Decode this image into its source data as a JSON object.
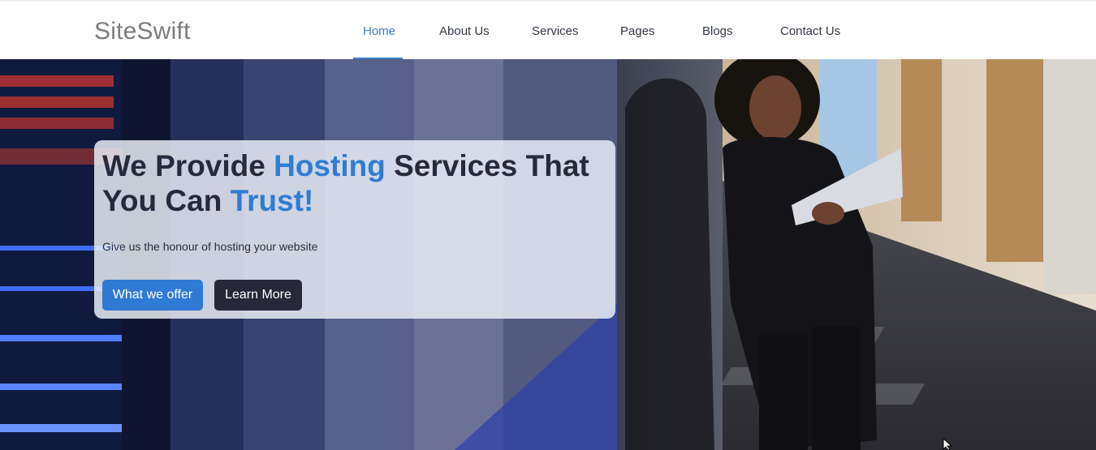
{
  "header": {
    "brand": "SiteSwift",
    "nav": [
      {
        "label": "Home",
        "active": true
      },
      {
        "label": "About Us",
        "active": false
      },
      {
        "label": "Services",
        "active": false
      },
      {
        "label": "Pages",
        "active": false
      },
      {
        "label": "Blogs",
        "active": false
      },
      {
        "label": "Contact Us",
        "active": false
      }
    ],
    "accent_color": "#3e7fc6"
  },
  "hero": {
    "title_part1": "We Provide ",
    "title_accent1": "Hosting",
    "title_part2": " Services That You Can ",
    "title_accent2": "Trust!",
    "subtitle": "Give us the honour of hosting your website",
    "primary_button": "What we offer",
    "secondary_button": "Learn More",
    "accent_color": "#2f7dd1",
    "background_image": "server-room-woman-with-laptop"
  }
}
